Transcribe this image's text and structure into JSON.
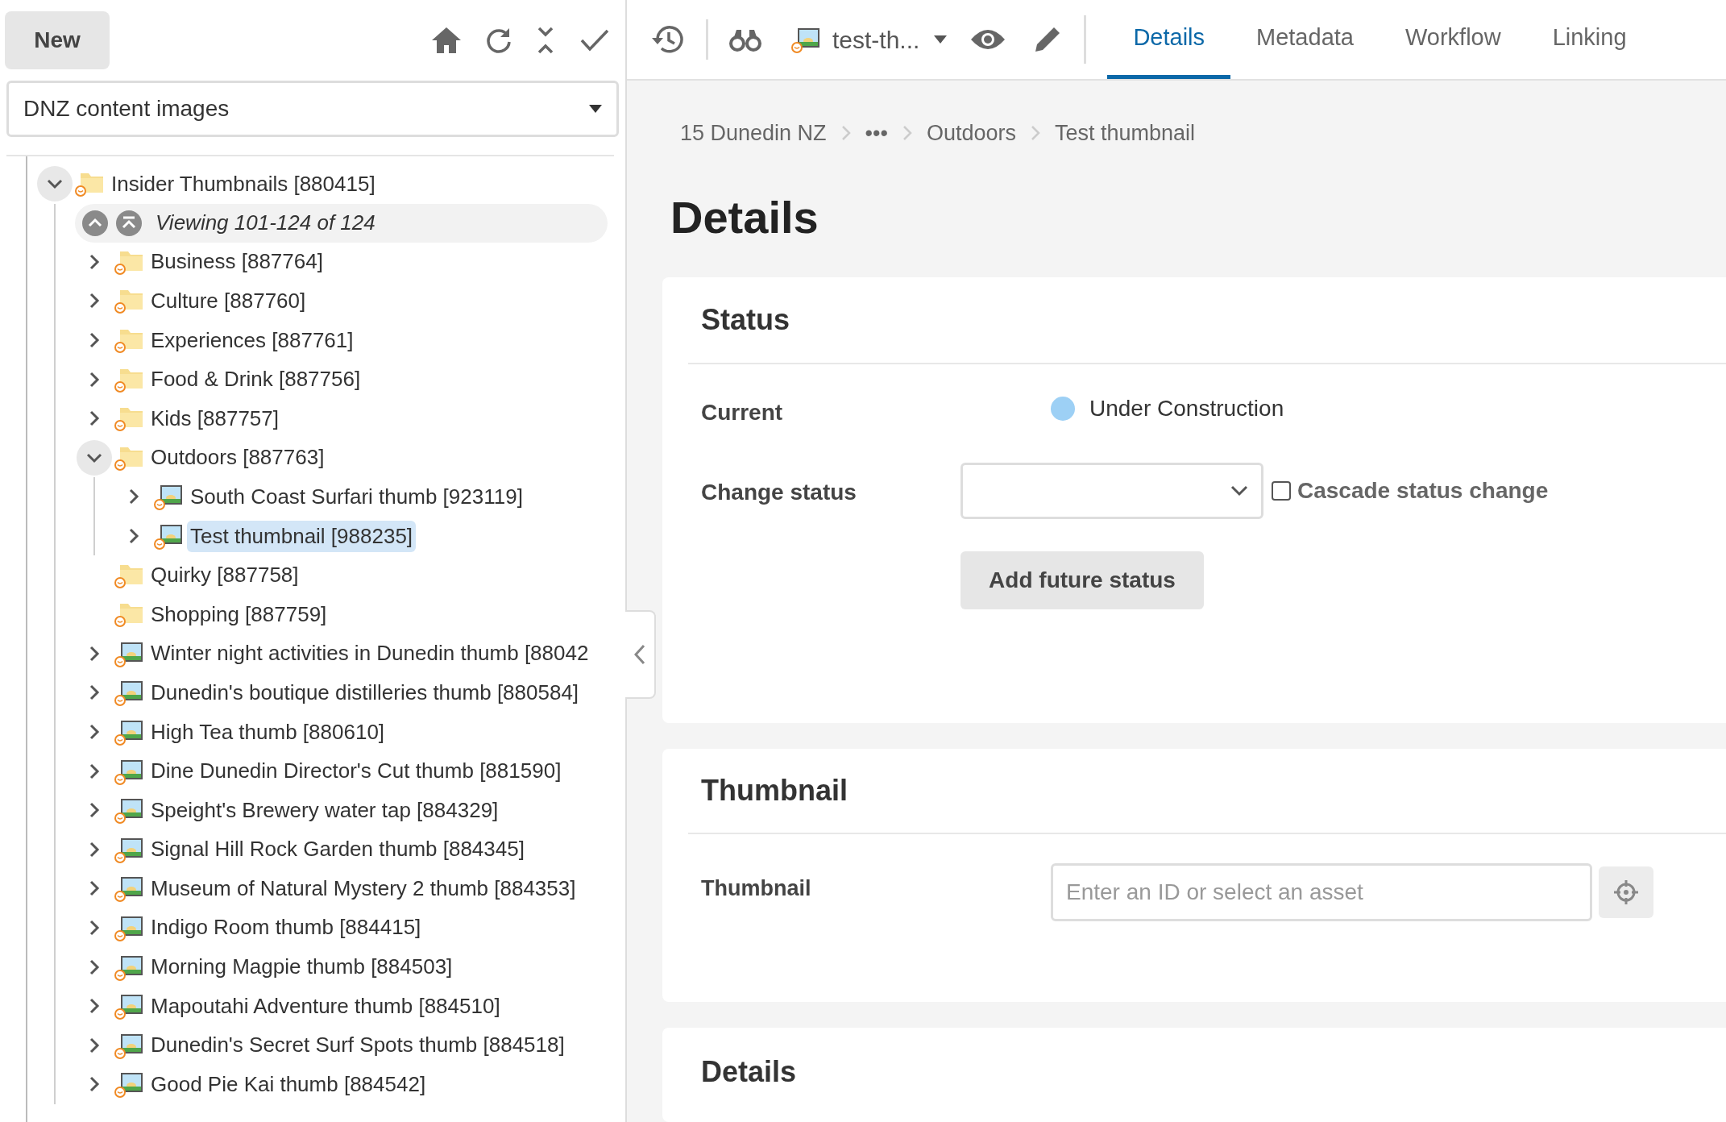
{
  "left_toolbar": {
    "new_button": "New"
  },
  "site_select": {
    "value": "DNZ content images"
  },
  "tree": [
    {
      "label": "Insider Thumbnails [880415]",
      "kind": "folder",
      "expandable": true,
      "expanded": true,
      "selected": false,
      "children": [
        {
          "kind": "pager",
          "label": "Viewing 101-124 of 124"
        },
        {
          "label": "Business [887764]",
          "kind": "folder",
          "expandable": true,
          "expanded": false,
          "selected": false
        },
        {
          "label": "Culture [887760]",
          "kind": "folder",
          "expandable": true,
          "expanded": false,
          "selected": false
        },
        {
          "label": "Experiences [887761]",
          "kind": "folder",
          "expandable": true,
          "expanded": false,
          "selected": false
        },
        {
          "label": "Food & Drink [887756]",
          "kind": "folder",
          "expandable": true,
          "expanded": false,
          "selected": false
        },
        {
          "label": "Kids [887757]",
          "kind": "folder",
          "expandable": true,
          "expanded": false,
          "selected": false
        },
        {
          "label": "Outdoors [887763]",
          "kind": "folder",
          "expandable": true,
          "expanded": true,
          "selected": false,
          "children": [
            {
              "label": "South Coast Surfari thumb [923119]",
              "kind": "image",
              "expandable": true,
              "expanded": false,
              "selected": false
            },
            {
              "label": "Test thumbnail [988235]",
              "kind": "image",
              "expandable": true,
              "expanded": false,
              "selected": true
            }
          ]
        },
        {
          "label": "Quirky [887758]",
          "kind": "folder",
          "expandable": false,
          "selected": false
        },
        {
          "label": "Shopping [887759]",
          "kind": "folder",
          "expandable": false,
          "selected": false
        },
        {
          "label": "Winter night activities in Dunedin thumb [88042",
          "kind": "image",
          "expandable": true,
          "expanded": false,
          "selected": false
        },
        {
          "label": "Dunedin's boutique distilleries thumb [880584]",
          "kind": "image",
          "expandable": true,
          "expanded": false,
          "selected": false
        },
        {
          "label": "High Tea thumb [880610]",
          "kind": "image",
          "expandable": true,
          "expanded": false,
          "selected": false
        },
        {
          "label": "Dine Dunedin Director's Cut thumb [881590]",
          "kind": "image",
          "expandable": true,
          "expanded": false,
          "selected": false
        },
        {
          "label": "Speight's Brewery water tap [884329]",
          "kind": "image",
          "expandable": true,
          "expanded": false,
          "selected": false
        },
        {
          "label": "Signal Hill Rock Garden thumb [884345]",
          "kind": "image",
          "expandable": true,
          "expanded": false,
          "selected": false
        },
        {
          "label": "Museum of Natural Mystery 2 thumb [884353]",
          "kind": "image",
          "expandable": true,
          "expanded": false,
          "selected": false
        },
        {
          "label": "Indigo Room thumb [884415]",
          "kind": "image",
          "expandable": true,
          "expanded": false,
          "selected": false
        },
        {
          "label": "Morning Magpie thumb [884503]",
          "kind": "image",
          "expandable": true,
          "expanded": false,
          "selected": false
        },
        {
          "label": "Mapoutahi Adventure thumb [884510]",
          "kind": "image",
          "expandable": true,
          "expanded": false,
          "selected": false
        },
        {
          "label": "Dunedin's Secret Surf Spots thumb [884518]",
          "kind": "image",
          "expandable": true,
          "expanded": false,
          "selected": false
        },
        {
          "label": "Good Pie Kai thumb [884542]",
          "kind": "image",
          "expandable": true,
          "expanded": false,
          "selected": false
        }
      ]
    }
  ],
  "asset_toolbar": {
    "asset_name": "test-th..."
  },
  "tabs": [
    {
      "label": "Details",
      "selected": true
    },
    {
      "label": "Metadata",
      "selected": false
    },
    {
      "label": "Workflow",
      "selected": false
    },
    {
      "label": "Linking",
      "selected": false
    }
  ],
  "breadcrumb": [
    "15 Dunedin NZ",
    "•••",
    "Outdoors",
    "Test thumbnail"
  ],
  "page_title": "Details",
  "status_section": {
    "title": "Status",
    "current_label": "Current",
    "current": {
      "value": "Under Construction",
      "color": "#9dd0f5"
    },
    "change_label": "Change status",
    "cascade_label": "Cascade status change",
    "cascade_checked": false,
    "add_button": "Add future status"
  },
  "thumbnail_section": {
    "title": "Thumbnail",
    "field_label": "Thumbnail",
    "placeholder": "Enter an ID or select an asset"
  },
  "details_section": {
    "title": "Details"
  }
}
